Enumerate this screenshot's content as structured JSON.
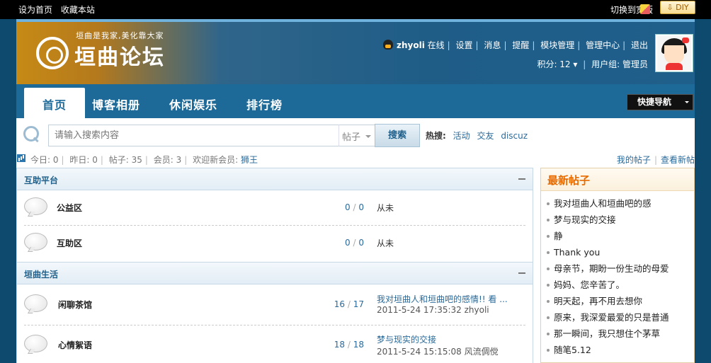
{
  "topbar": {
    "set_home": "设为首页",
    "bookmark": "收藏本站",
    "switch_wide": "切换到宽版",
    "diy_label": "DIY"
  },
  "header": {
    "slogan": "垣曲是我家,美化靠大家",
    "site_name": "垣曲论坛",
    "user": {
      "username": "zhyoli",
      "online": "在线",
      "links": [
        "设置",
        "消息",
        "提醒",
        "模块管理",
        "管理中心",
        "退出"
      ],
      "points": "积分: 12",
      "group": "用户组: 管理员"
    }
  },
  "nav": {
    "tabs": [
      "首页",
      "博客相册",
      "休闲娱乐",
      "排行榜"
    ],
    "quick_nav": "快捷导航"
  },
  "search": {
    "placeholder": "请输入搜索内容",
    "scope": "帖子",
    "button": "搜索",
    "hot_label": "热搜:",
    "hot_terms": [
      "活动",
      "交友",
      "discuz"
    ]
  },
  "stats": {
    "today": "今日: 0",
    "yesterday": "昨日: 0",
    "posts": "帖子: 35",
    "members": "会员: 3",
    "welcome_prefix": "欢迎新会员: ",
    "newest_member": "狮王",
    "my_posts": "我的帖子",
    "new_posts": "查看新帖"
  },
  "forum": {
    "categories": [
      {
        "title": "互助平台",
        "boards": [
          {
            "name": "公益区",
            "threads": "0",
            "posts": "0",
            "last": "从未"
          },
          {
            "name": "互助区",
            "threads": "0",
            "posts": "0",
            "last": "从未"
          }
        ]
      },
      {
        "title": "垣曲生活",
        "boards": [
          {
            "name": "闲聊茶馆",
            "threads": "16",
            "posts": "17",
            "last": "我对垣曲人和垣曲吧的感情!! 看 ...",
            "time": "2011-5-24 17:35:32 zhyoli"
          },
          {
            "name": "心情絮语",
            "threads": "18",
            "posts": "18",
            "last": "梦与现实的交接",
            "time": "2011-5-24 15:15:08 风流倜傥"
          }
        ]
      }
    ]
  },
  "sidebar": {
    "title": "最新帖子",
    "items": [
      "我对垣曲人和垣曲吧的感",
      "梦与现实的交接",
      "静",
      "Thank you",
      "母亲节，期盼一份生动的母爱",
      "妈妈、您辛苦了。",
      "明天起，再不用去想你",
      "原来，我深爱最爱的只是普通",
      "那一瞬间，我只想住个茅草",
      "随笔5.12"
    ]
  }
}
